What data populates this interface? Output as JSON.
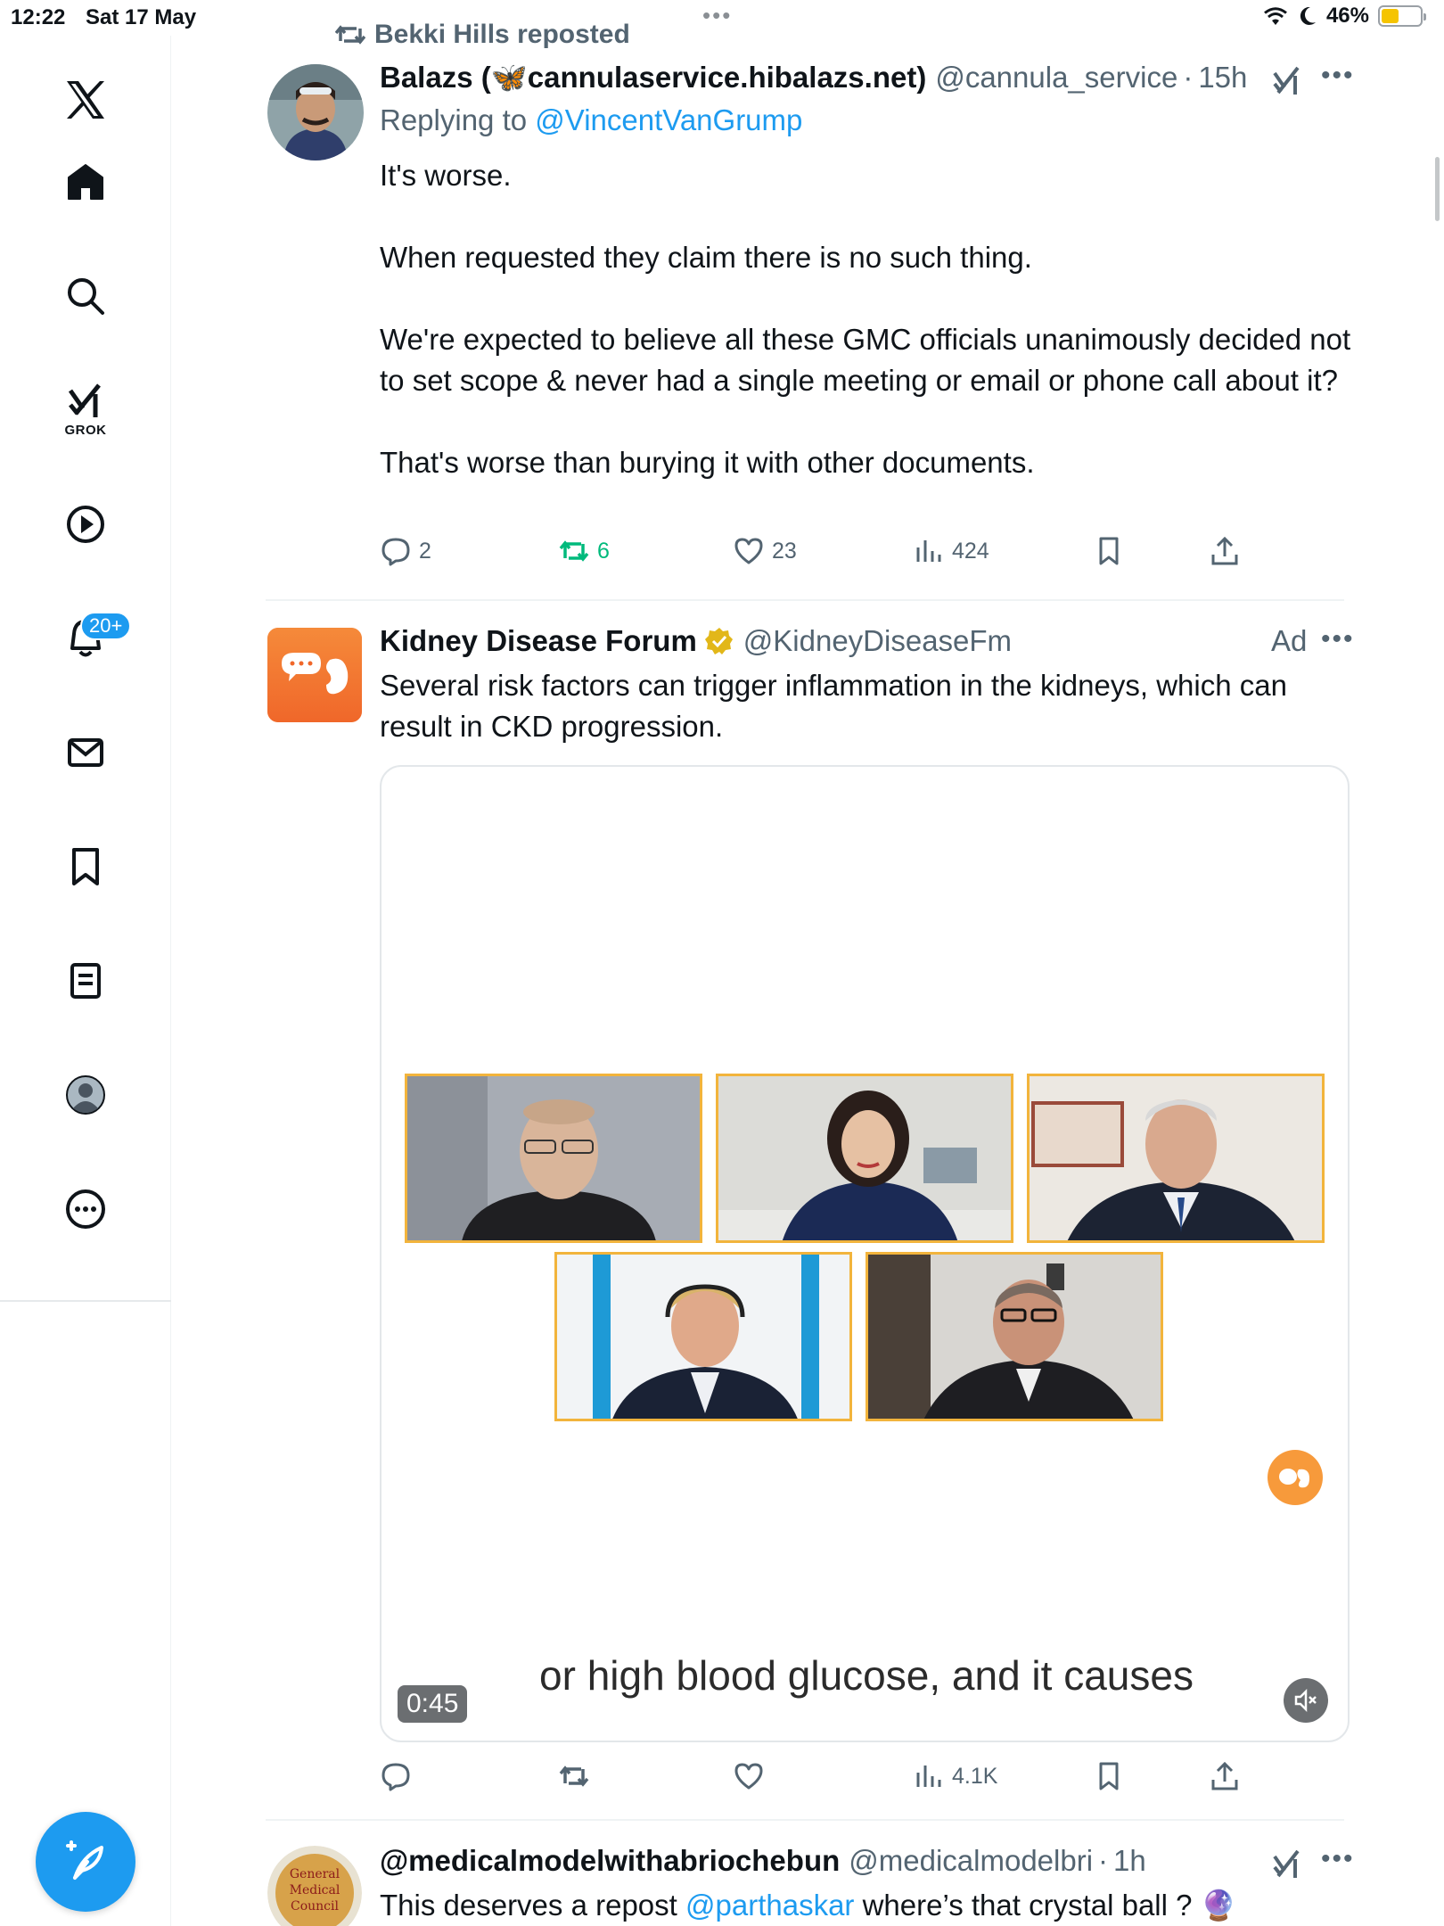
{
  "status_bar": {
    "time": "12:22",
    "date": "Sat 17 May",
    "battery": "46%",
    "battery_level": 0.46,
    "battery_color": "#f5c400"
  },
  "sidebar": {
    "items": [
      {
        "name": "x-logo-icon"
      },
      {
        "name": "home-icon"
      },
      {
        "name": "search-icon"
      },
      {
        "name": "grok-icon",
        "label": "GROK"
      },
      {
        "name": "videos-icon"
      },
      {
        "name": "notifications-icon",
        "badge": "20+"
      },
      {
        "name": "messages-icon"
      },
      {
        "name": "bookmarks-icon"
      },
      {
        "name": "lists-icon"
      },
      {
        "name": "profile-icon"
      },
      {
        "name": "more-icon"
      }
    ],
    "compose_icon": "compose-feather-icon"
  },
  "tweet1": {
    "repost_by": "Bekki Hills reposted",
    "name": "Balazs (🦋cannulaservice.hibalazs.net)",
    "handle": "@cannula_service",
    "dot": "·",
    "time": "15h",
    "replying_prefix": "Replying to",
    "replying_to": "@VincentVanGrump",
    "text_lines": [
      "It's worse.",
      "When requested they claim there is no such thing.",
      "We're expected to believe all these GMC officials unanimously decided not to set scope & never had a single meeting or email or phone call about it?",
      "That's worse than burying it with other documents."
    ],
    "actions": {
      "replies": "2",
      "reposts": "6",
      "likes": "23",
      "views": "424"
    }
  },
  "tweet2": {
    "name": "Kidney Disease Forum",
    "handle": "@KidneyDiseaseFm",
    "ad_label": "Ad",
    "text": "Several risk factors can trigger inflammation in the kidneys, which can result in CKD progression.",
    "video": {
      "caption": "or high blood glucose, and it causes",
      "duration": "0:45",
      "frame_border_color": "#f2b43c"
    },
    "actions": {
      "replies": "",
      "reposts": "",
      "likes": "",
      "views": "4.1K"
    }
  },
  "tweet3": {
    "name": "@medicalmodelwithabriochebun",
    "handle": "@medicalmodelbri",
    "dot": "·",
    "time": "1h",
    "text_prefix": "This deserves a repost",
    "mention": "@parthaskar",
    "text_suffix": "where’s that crystal ball ? 🔮",
    "avatar_text": [
      "General",
      "Medical",
      "Council"
    ]
  },
  "colors": {
    "accent": "#1d9bf0",
    "retweet_green": "#00ba7c",
    "secondary_text": "#536471",
    "ad_brand_orange": "#f79a3b"
  }
}
